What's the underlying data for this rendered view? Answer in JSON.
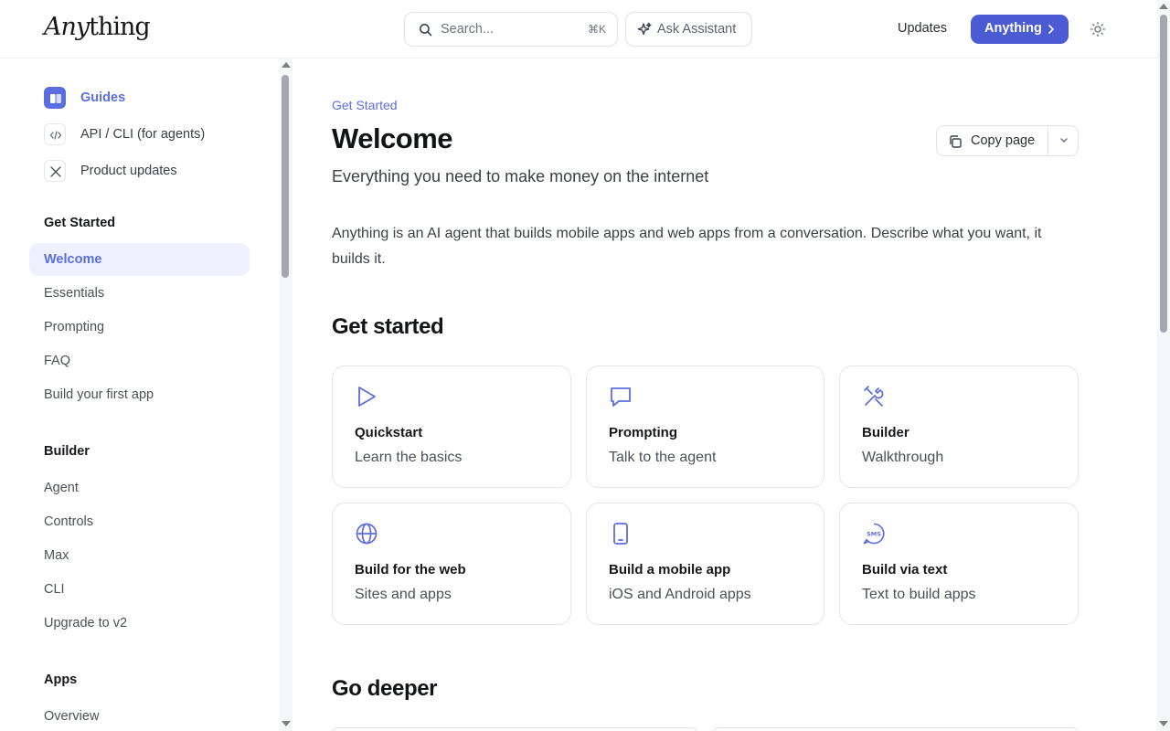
{
  "header": {
    "logo_italic": "Any",
    "logo_rest": "thing",
    "search_placeholder": "Search...",
    "search_shortcut": "⌘K",
    "assistant_label": "Ask Assistant",
    "updates_label": "Updates",
    "cta_label": "Anything",
    "icons": {
      "search": "search-icon",
      "assistant": "sparkle-icon",
      "theme": "sun-icon"
    }
  },
  "sidebar": {
    "top_items": [
      {
        "label": "Guides",
        "icon": "book-icon",
        "active": true
      },
      {
        "label": "API / CLI (for agents)",
        "icon": "code-icon",
        "active": false
      },
      {
        "label": "Product updates",
        "icon": "x-logo-icon",
        "active": false
      }
    ],
    "sections": [
      {
        "title": "Get Started",
        "items": [
          "Welcome",
          "Essentials",
          "Prompting",
          "FAQ",
          "Build your first app"
        ]
      },
      {
        "title": "Builder",
        "items": [
          "Agent",
          "Controls",
          "Max",
          "CLI",
          "Upgrade to v2"
        ]
      },
      {
        "title": "Apps",
        "items": [
          "Overview"
        ]
      }
    ],
    "active_item": "Welcome"
  },
  "main": {
    "breadcrumb": "Get Started",
    "title": "Welcome",
    "subtitle": "Everything you need to make money on the internet",
    "copy_label": "Copy page",
    "intro": "Anything is an AI agent that builds mobile apps and web apps from a conversation. Describe what you want, it builds it.",
    "get_started_heading": "Get started",
    "cards": [
      {
        "title": "Quickstart",
        "desc": "Learn the basics",
        "icon": "play-icon"
      },
      {
        "title": "Prompting",
        "desc": "Talk to the agent",
        "icon": "chat-icon"
      },
      {
        "title": "Builder",
        "desc": "Walkthrough",
        "icon": "tools-icon"
      },
      {
        "title": "Build for the web",
        "desc": "Sites and apps",
        "icon": "globe-icon"
      },
      {
        "title": "Build a mobile app",
        "desc": "iOS and Android apps",
        "icon": "phone-icon"
      },
      {
        "title": "Build via text",
        "desc": "Text to build apps",
        "icon": "sms-icon"
      }
    ],
    "go_deeper_heading": "Go deeper"
  },
  "colors": {
    "accent": "#5b6ee0",
    "cta": "#4a5bd4",
    "active_bg": "#eef0fd"
  }
}
